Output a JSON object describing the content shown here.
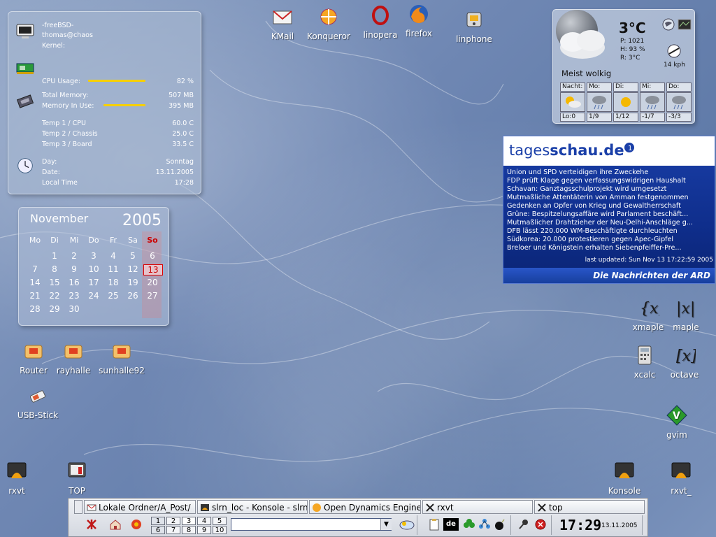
{
  "sysinfo": {
    "os": "-freeBSD-",
    "user_host": "thomas@chaos",
    "kernel_label": "Kernel:",
    "cpu_label": "CPU Usage:",
    "cpu_value": "82 %",
    "cpu_fraction": 0.82,
    "mem_total_label": "Total Memory:",
    "mem_total_value": "507 MB",
    "mem_used_label": "Memory In Use:",
    "mem_used_value": "395 MB",
    "mem_fraction": 0.78,
    "temp1_label": "Temp 1 / CPU",
    "temp1_value": "60.0 C",
    "temp2_label": "Temp 2 / Chassis",
    "temp2_value": "25.0 C",
    "temp3_label": "Temp 3 / Board",
    "temp3_value": "33.5 C",
    "day_label": "Day:",
    "day_value": "Sonntag",
    "date_label": "Date:",
    "date_value": "13.11.2005",
    "time_label": "Local Time",
    "time_value": "17:28"
  },
  "calendar": {
    "month": "November",
    "year": "2005",
    "weekdays": [
      "Mo",
      "Di",
      "Mi",
      "Do",
      "Fr",
      "Sa",
      "So"
    ],
    "rows": [
      [
        "",
        "1",
        "2",
        "3",
        "4",
        "5",
        "6"
      ],
      [
        "7",
        "8",
        "9",
        "10",
        "11",
        "12",
        "13"
      ],
      [
        "14",
        "15",
        "16",
        "17",
        "18",
        "19",
        "20"
      ],
      [
        "21",
        "22",
        "23",
        "24",
        "25",
        "26",
        "27"
      ],
      [
        "28",
        "29",
        "30",
        "",
        "",
        "",
        ""
      ]
    ],
    "today": "13"
  },
  "weather": {
    "temp": "3°C",
    "pressure": "P: 1021",
    "humidity": "H: 93 %",
    "dew": "R: 3°C",
    "wind": "14 kph",
    "description": "Meist wolkig",
    "forecast": [
      {
        "day": "Nacht:",
        "value": "Lo:0"
      },
      {
        "day": "Mo:",
        "value": "1/9"
      },
      {
        "day": "Di:",
        "value": "1/12"
      },
      {
        "day": "Mi:",
        "value": "-1/7"
      },
      {
        "day": "Do:",
        "value": "-3/3"
      }
    ]
  },
  "tagesschau": {
    "logo_plain": "tages",
    "logo_bold": "schau.de",
    "items": [
      "Union und SPD verteidigen ihre Zweckehe",
      "FDP prüft Klage gegen verfassungswidrigen Haushalt",
      "Schavan: Ganztagsschulprojekt wird umgesetzt",
      "Mutmaßliche Attentäterin von Amman festgenommen",
      "Gedenken an Opfer von Krieg und Gewaltherrschaft",
      "Grüne: Bespitzelungsaffäre wird Parlament beschäft...",
      "Mutmaßlicher Drahtzieher der Neu-Delhi-Anschläge g...",
      "DFB lässt 220.000 WM-Beschäftigte durchleuchten",
      "Südkorea: 20.000 protestieren gegen Apec-Gipfel",
      "Breloer und Königstein erhalten Siebenpfeiffer-Pre..."
    ],
    "updated": "last updated: Sun Nov 13 17:22:59 2005",
    "footer": "Die Nachrichten der ARD"
  },
  "desktop_icons": {
    "kmail": "KMail",
    "konqueror": "Konqueror",
    "linopera": "linopera",
    "firefox": "firefox",
    "linphone": "linphone",
    "router": "Router",
    "rayhalle": "rayhalle",
    "sunhalle": "sunhalle92",
    "usb": "USB-Stick",
    "rxvt_left": "rxvt",
    "top": "TOP",
    "xmaple": "xmaple",
    "maple": "maple",
    "xcalc": "xcalc",
    "octave": "octave",
    "gvim": "gvim",
    "konsole": "Konsole",
    "rxvt_right": "rxvt_"
  },
  "taskbar": {
    "tasks": [
      "Lokale Ordner/A_Post/",
      "slrn_loc - Konsole - slrn",
      "Open Dynamics Engine",
      "rxvt",
      "top"
    ],
    "pager": [
      "1",
      "2",
      "3",
      "4",
      "5",
      "6",
      "7",
      "8",
      "9",
      "10"
    ],
    "clock_time": "17:29",
    "clock_date": "13.11.2005",
    "lang": "de"
  },
  "colors": {
    "bar": "#f7d000",
    "today_border": "#d00000",
    "tagesschau_blue": "#1a3fa8"
  }
}
